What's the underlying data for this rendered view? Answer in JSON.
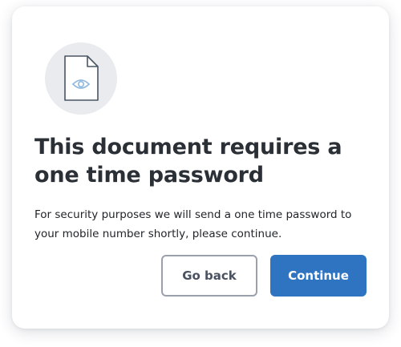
{
  "dialog": {
    "icon": "document-eye-icon",
    "title": "This document requires a one time password",
    "message": "For security purposes we will send a one time password to your mobile number shortly, please continue.",
    "buttons": {
      "back_label": "Go back",
      "continue_label": "Continue"
    }
  },
  "colors": {
    "primary": "#2f74c0",
    "icon_bg": "#e9ebef",
    "title": "#2b2f36"
  }
}
